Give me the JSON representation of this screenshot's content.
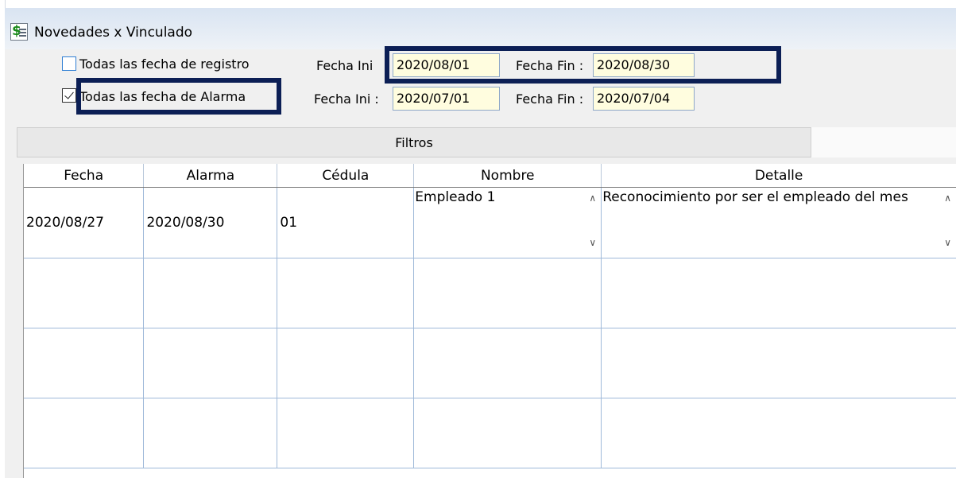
{
  "window": {
    "title": "Novedades x Vinculado",
    "icon": "dollar-document-icon"
  },
  "filters": {
    "registro": {
      "checked": false,
      "label": "Todas las fecha de registro",
      "fecha_ini_label": "Fecha Ini",
      "fecha_ini": "2020/08/01",
      "fecha_fin_label": "Fecha Fin :",
      "fecha_fin": "2020/08/30"
    },
    "alarma": {
      "checked": true,
      "label": "Todas las fecha de Alarma",
      "fecha_ini_label": "Fecha Ini :",
      "fecha_ini": "2020/07/01",
      "fecha_fin_label": "Fecha Fin :",
      "fecha_fin": "2020/07/04"
    }
  },
  "tab": {
    "label": "Filtros"
  },
  "grid": {
    "columns": [
      "Fecha",
      "Alarma",
      "Cédula",
      "Nombre",
      "Detalle"
    ],
    "rows": [
      {
        "fecha": "2020/08/27",
        "alarma": "2020/08/30",
        "cedula": "01",
        "nombre": "Empleado 1",
        "detalle": "Reconocimiento por ser el empleado del mes"
      }
    ]
  },
  "colors": {
    "highlight_box": "#0c1f55",
    "input_bg": "#fffddf",
    "checkbox_blue": "#2f7fd4"
  }
}
